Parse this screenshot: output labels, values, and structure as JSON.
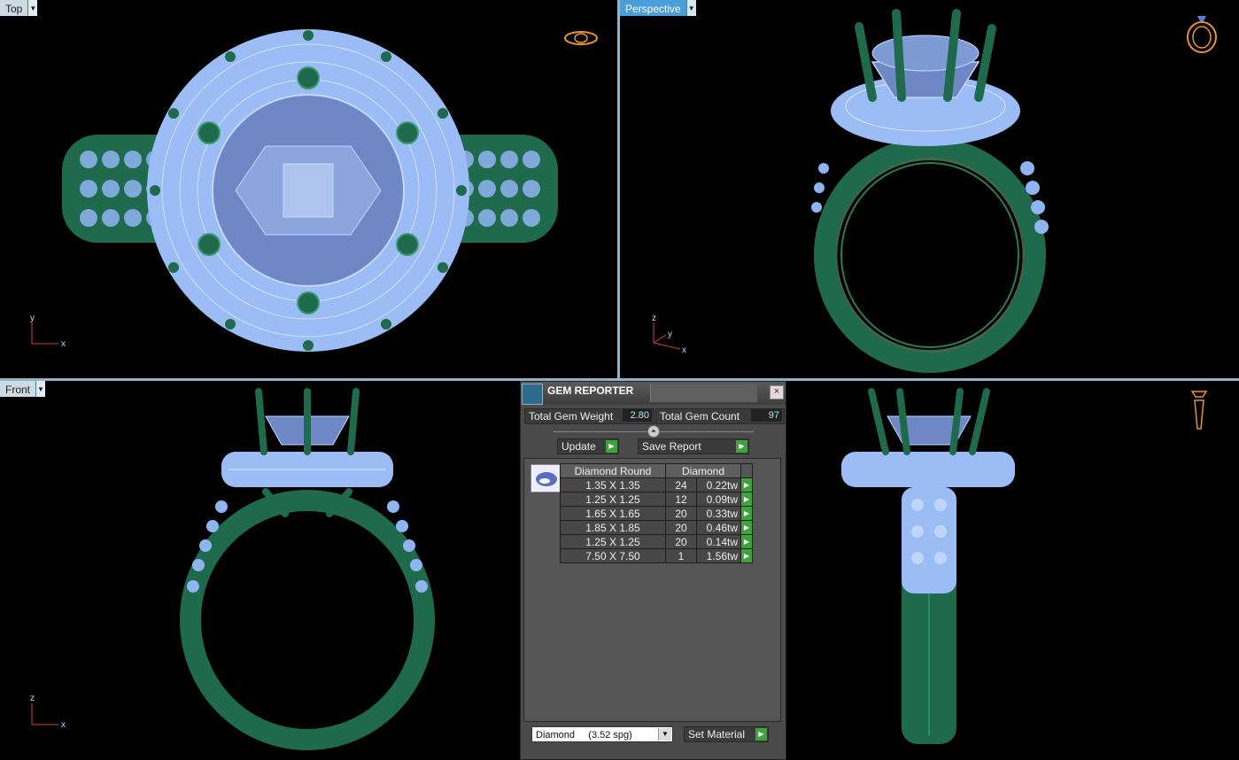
{
  "viewports": {
    "top": {
      "label": "Top"
    },
    "perspective": {
      "label": "Perspective"
    },
    "front": {
      "label": "Front"
    },
    "right": {
      "label": ""
    }
  },
  "axes": {
    "top": [
      "y",
      "x"
    ],
    "perspective": [
      "z",
      "y",
      "x"
    ],
    "front": [
      "z",
      "x"
    ]
  },
  "gem_reporter": {
    "title": "GEM REPORTER",
    "close_icon": "×",
    "total_weight_label": "Total Gem Weight",
    "total_weight_value": "2.80",
    "total_count_label": "Total Gem Count",
    "total_count_value": "97",
    "update_label": "Update",
    "save_report_label": "Save Report",
    "table_headers": {
      "shape": "Diamond Round",
      "material": "Diamond"
    },
    "rows": [
      {
        "size": "1.35 X 1.35",
        "qty": "24",
        "weight": "0.22tw"
      },
      {
        "size": "1.25 X 1.25",
        "qty": "12",
        "weight": "0.09tw"
      },
      {
        "size": "1.65 X 1.65",
        "qty": "20",
        "weight": "0.33tw"
      },
      {
        "size": "1.85 X 1.85",
        "qty": "20",
        "weight": "0.46tw"
      },
      {
        "size": "1.25 X 1.25",
        "qty": "20",
        "weight": "0.14tw"
      },
      {
        "size": "7.50 X 7.50",
        "qty": "1",
        "weight": "1.56tw"
      }
    ],
    "material_select": "Diamond     (3.52 spg)",
    "set_material_label": "Set Material"
  },
  "colors": {
    "metal": "#1f6a4c",
    "gem": "#8fb4f2",
    "accent": "#4a9fd8",
    "play_button": "#3ea33a"
  }
}
